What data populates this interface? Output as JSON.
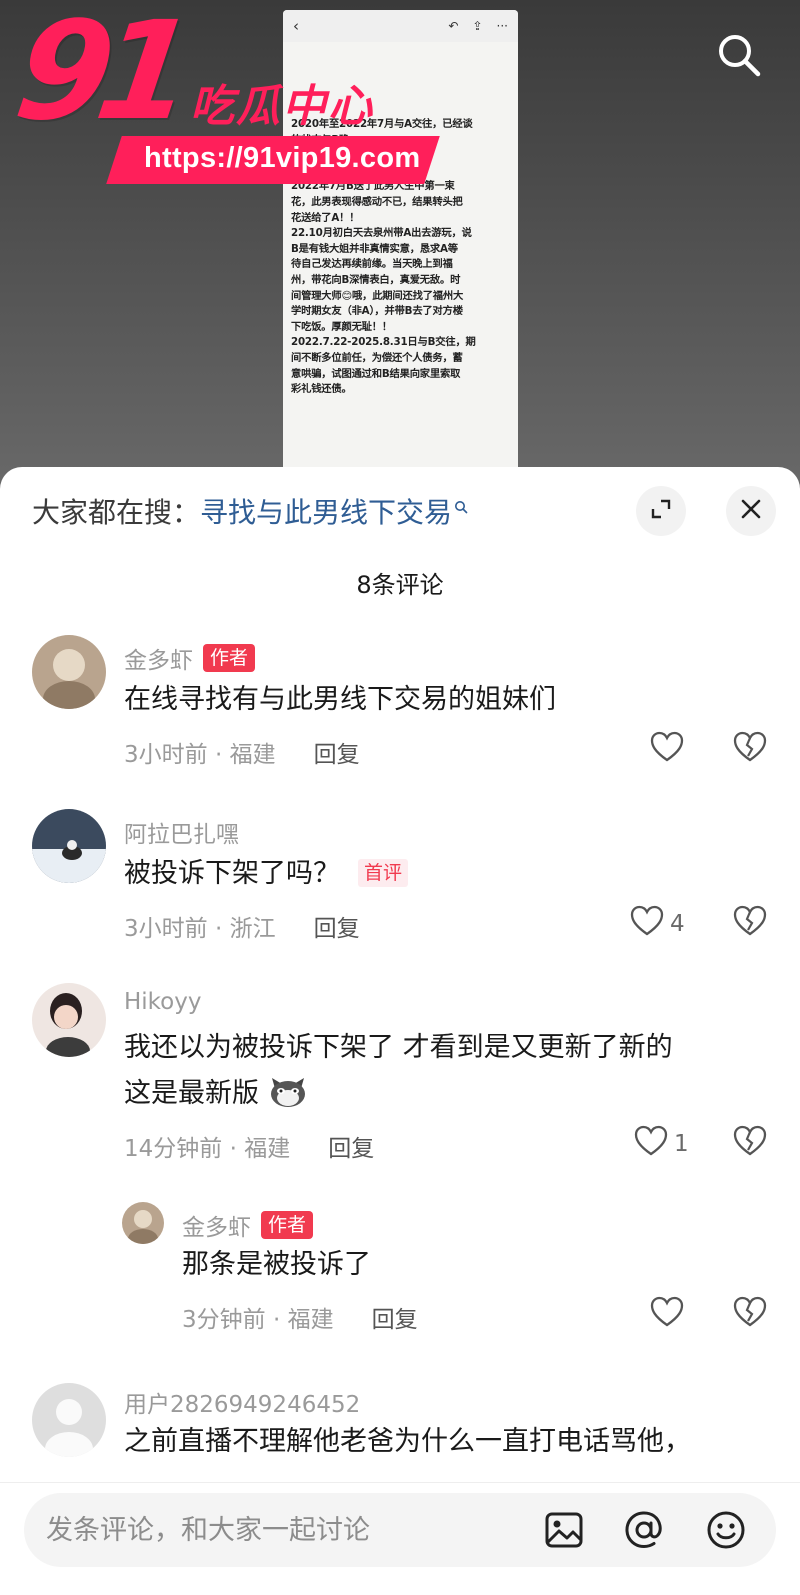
{
  "screenshot": {
    "back_glyph": "‹",
    "paragraph": "2020年至2022年7月与A交往，已经谈\n的状态与B确\n定，后又纠缠\nA多年，A因此内耗折磨多年。\n2022年7月B送了此男人生中第一束\n花，此男表现得感动不已，结果转头把\n花送给了A！！\n22.10月初白天去泉州带A出去游玩，说\nB是有钱大姐并非真情实意，恳求A等\n待自己发达再续前缘。当天晚上到福\n州，带花向B深情表白，真爱无敌。时\n间管理大师😊哦，此期间还找了福州大\n学时期女友（非A），并带B去了对方楼\n下吃饭。厚颜无耻！！\n2022.7.22-2025.8.31日与B交往，期\n间不断多位前任，为偿还个人债务，蓄\n意哄骗，试图通过和B结果向家里索取\n彩礼钱还债。"
  },
  "watermark": {
    "number": "91",
    "title": "吃瓜中心",
    "url": "https://91vip19.com"
  },
  "header": {
    "hot_search_prefix": "大家都在搜：",
    "hot_search_term": "寻找与此男线下交易"
  },
  "comment_count": "8条评论",
  "comments": [
    {
      "username": "金多虾",
      "badge": "作者",
      "text": "在线寻找有与此男线下交易的姐妹们",
      "meta": "3小时前 · 福建",
      "reply_label": "回复",
      "likes": ""
    },
    {
      "username": "阿拉巴扎嘿",
      "text": "被投诉下架了吗？",
      "first_badge": "首评",
      "meta": "3小时前 · 浙江",
      "reply_label": "回复",
      "likes": "4"
    },
    {
      "username": "Hikoyy",
      "text_line1": "我还以为被投诉下架了 才看到是又更新了新的",
      "text_line2": "这是最新版",
      "meta": "14分钟前 · 福建",
      "reply_label": "回复",
      "likes": "1"
    },
    {
      "username": "金多虾",
      "badge": "作者",
      "text": "那条是被投诉了",
      "meta": "3分钟前 · 福建",
      "reply_label": "回复",
      "likes": ""
    },
    {
      "username": "用户2826949246452",
      "text": "之前直播不理解他老爸为什么一直打电话骂他，"
    }
  ],
  "input": {
    "placeholder": "发条评论，和大家一起讨论"
  },
  "icons": [
    "search-icon",
    "expand-icon",
    "close-icon",
    "heart-icon",
    "broken-heart-icon",
    "image-icon",
    "at-icon",
    "emoji-icon"
  ],
  "colors": {
    "accent_red": "#f13a4f",
    "watermark_pink": "#ff1f5a",
    "link_blue": "#2f5d94"
  }
}
